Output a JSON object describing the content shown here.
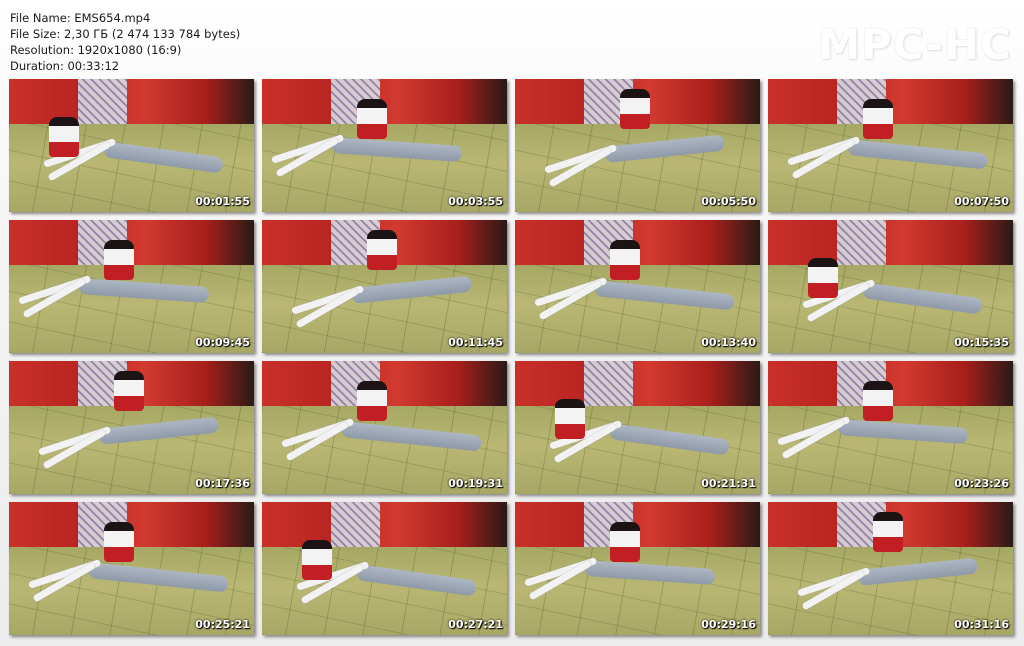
{
  "info": {
    "file_name": "File Name: EMS654.mp4",
    "file_size": "File Size: 2,30 ГБ (2 474 133 784 bytes)",
    "resolution": "Resolution: 1920x1080 (16:9)",
    "duration": "Duration: 00:33:12"
  },
  "logo": "MPC-HC",
  "thumbnails": [
    "00:01:55",
    "00:03:55",
    "00:05:50",
    "00:07:50",
    "00:09:45",
    "00:11:45",
    "00:13:40",
    "00:15:35",
    "00:17:36",
    "00:19:31",
    "00:21:31",
    "00:23:26",
    "00:25:21",
    "00:27:21",
    "00:29:16",
    "00:31:16"
  ]
}
